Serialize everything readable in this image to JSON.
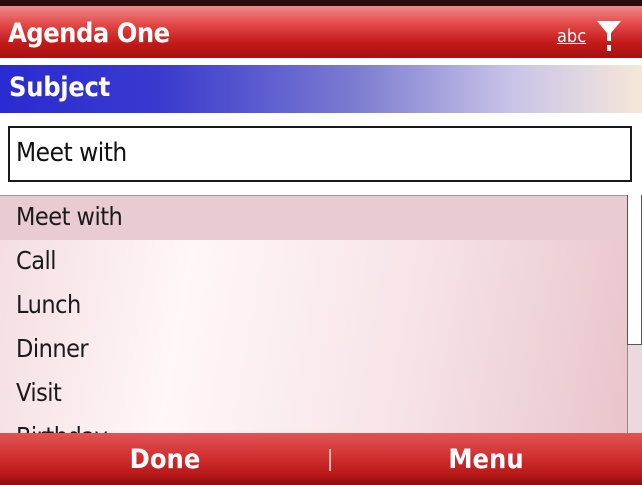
{
  "title_bar": {
    "app_title": "Agenda One",
    "input_mode": "abc",
    "signal_icon": "signal-antenna-icon"
  },
  "subject_bar": {
    "label": "Subject"
  },
  "input": {
    "value": "Meet with"
  },
  "list": {
    "items": [
      {
        "label": "Meet with",
        "selected": true
      },
      {
        "label": "Call"
      },
      {
        "label": "Lunch"
      },
      {
        "label": "Dinner"
      },
      {
        "label": "Visit"
      },
      {
        "label": "Birthday"
      }
    ]
  },
  "softkeys": {
    "left": "Done",
    "right": "Menu"
  },
  "colors": {
    "title_red": "#c41b1b",
    "subject_blue": "#2a2ad2",
    "selection": "#e9ccd1"
  }
}
